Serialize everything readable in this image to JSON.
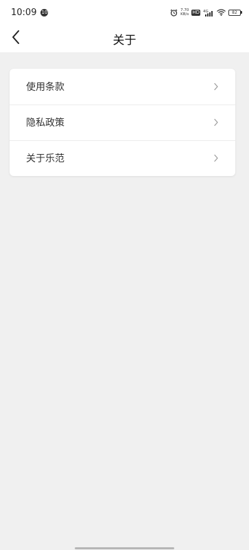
{
  "status_bar": {
    "time": "10:09",
    "notification_badge": "10",
    "net_speed_value": "7.70",
    "net_speed_unit": "KB/s",
    "hd_label": "HD",
    "signal_label": "4G",
    "battery_level": "82"
  },
  "nav": {
    "title": "关于"
  },
  "menu": {
    "items": [
      {
        "label": "使用条款"
      },
      {
        "label": "隐私政策"
      },
      {
        "label": "关于乐范"
      }
    ]
  },
  "icons": {
    "back": "chevron-left-icon",
    "chevron": "chevron-right-icon",
    "alarm": "alarm-icon",
    "signal": "signal-icon",
    "wifi": "wifi-icon",
    "battery": "battery-icon"
  },
  "colors": {
    "background": "#f0f0f0",
    "surface": "#ffffff",
    "divider": "#ececec",
    "text_primary": "#333333"
  }
}
